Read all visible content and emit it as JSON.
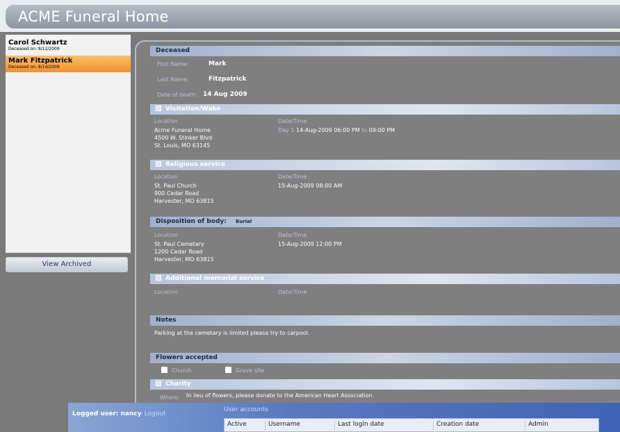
{
  "app": {
    "title": "ACME Funeral Home"
  },
  "sidebar": {
    "items": [
      {
        "name": "Carol Schwartz",
        "sub": "Deceased on: 8/12/2009",
        "selected": false
      },
      {
        "name": "Mark Fitzpatrick",
        "sub": "Deceased on: 8/14/2009",
        "selected": true
      }
    ],
    "archived_button": "View Archived"
  },
  "deceased": {
    "header": "Deceased",
    "first_name_label": "First Name:",
    "first_name": "Mark",
    "last_name_label": "Last Name:",
    "last_name": "Fitzpatrick",
    "date_label": "Date of death:",
    "date": "14 Aug 2009"
  },
  "visitation": {
    "header": "Visitation/Wake",
    "location_label": "Location",
    "datetime_label": "Date/Time",
    "loc1": "Acme Funeral Home",
    "loc2": "4500 W. Stinker Blvd",
    "loc3": "St. Louis, MO 63145",
    "day": "Day 1",
    "start": "14-Aug-2009 06:00 PM",
    "to": "to",
    "end": "09:00 PM"
  },
  "religious": {
    "header": "Religious service",
    "location_label": "Location",
    "datetime_label": "Date/Time",
    "loc1": "St. Paul Church",
    "loc2": "900 Cedar Road",
    "loc3": "Harvester, MO 63815",
    "datetime": "15-Aug-2009 08:00 AM"
  },
  "disposition": {
    "header": "Disposition of body:",
    "type": "Burial",
    "location_label": "Location",
    "datetime_label": "Date/Time",
    "loc1": "St. Paul Cemetary",
    "loc2": "1200 Cedar Road",
    "loc3": "Harvester, MO 63815",
    "datetime": "15-Aug-2009 12:00 PM"
  },
  "additional": {
    "header": "Additional memorial service",
    "location_label": "Location",
    "datetime_label": "Date/Time"
  },
  "notes": {
    "header": "Notes",
    "text": "Parking at the cemetary is limited please try to carpool."
  },
  "flowers": {
    "header": "Flowers accepted",
    "opt1": "Church",
    "opt2": "Grave site"
  },
  "charity": {
    "header": "Charity",
    "where_label": "Where:",
    "text": "In lieu of flowers, please donate to the American Heart Association."
  },
  "footer": {
    "logged_user": "Logged user: nancy",
    "logout": "Logout",
    "user_accounts": "User accounts",
    "columns": [
      "Active",
      "Username",
      "Last login date",
      "Creation date",
      "Admin"
    ]
  }
}
